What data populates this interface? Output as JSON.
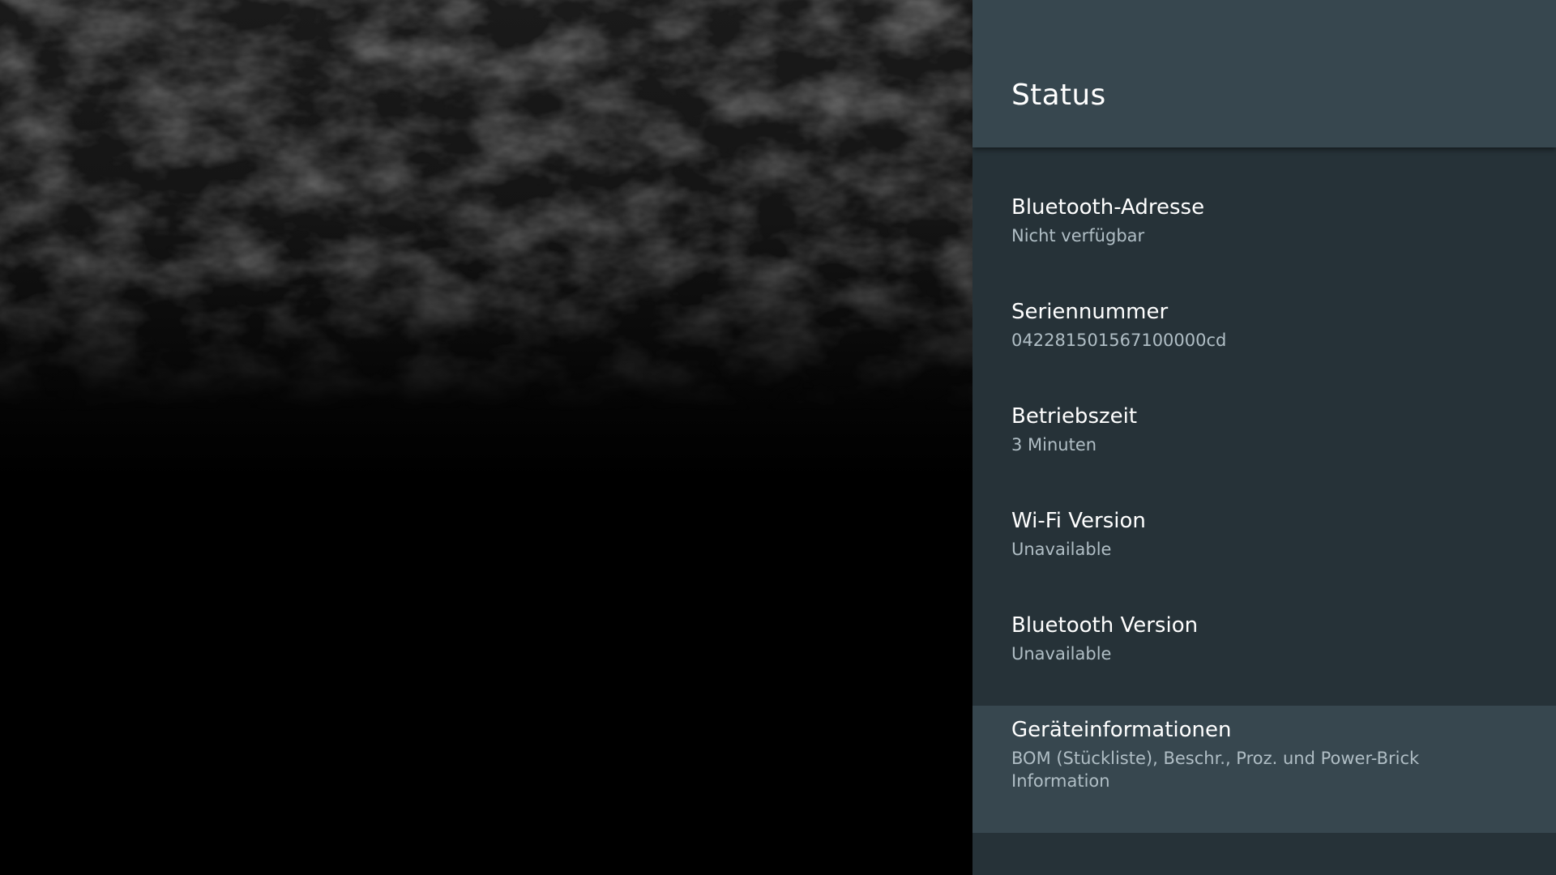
{
  "panel": {
    "title": "Status",
    "items": [
      {
        "title": "Bluetooth-Adresse",
        "subtitle": "Nicht verfügbar"
      },
      {
        "title": "Seriennummer",
        "subtitle": "0422815015671000​00cd"
      },
      {
        "title": "Betriebszeit",
        "subtitle": "3 Minuten"
      },
      {
        "title": "Wi-Fi Version",
        "subtitle": "Unavailable"
      },
      {
        "title": "Bluetooth Version",
        "subtitle": "Unavailable"
      },
      {
        "title": "Geräteinformationen",
        "subtitle": "BOM (Stückliste), Beschr., Proz. und Power-Brick Information"
      }
    ]
  },
  "colors": {
    "panel_background": "#263238",
    "header_background": "#37474f",
    "focused_item_background": "#37474f",
    "title_text": "#ffffff",
    "subtitle_text": "#b0bec5",
    "backdrop": "#000000"
  }
}
